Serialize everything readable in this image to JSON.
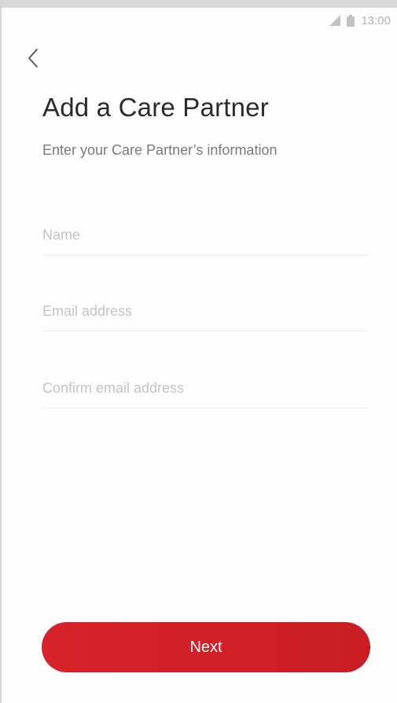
{
  "status_bar": {
    "time": "13:00",
    "signal_icon": "signal-icon",
    "battery_icon": "battery-icon",
    "icon_color": "#b3b3b3"
  },
  "header": {
    "back_icon": "chevron-left-icon",
    "title": "Add a Care Partner",
    "subtitle": "Enter your Care Partner’s information"
  },
  "form": {
    "name": {
      "value": "",
      "placeholder": "Name"
    },
    "email": {
      "value": "",
      "placeholder": "Email address"
    },
    "confirm_email": {
      "value": "",
      "placeholder": "Confirm email address"
    }
  },
  "actions": {
    "next_label": "Next",
    "accent_color": "#d9222b"
  }
}
